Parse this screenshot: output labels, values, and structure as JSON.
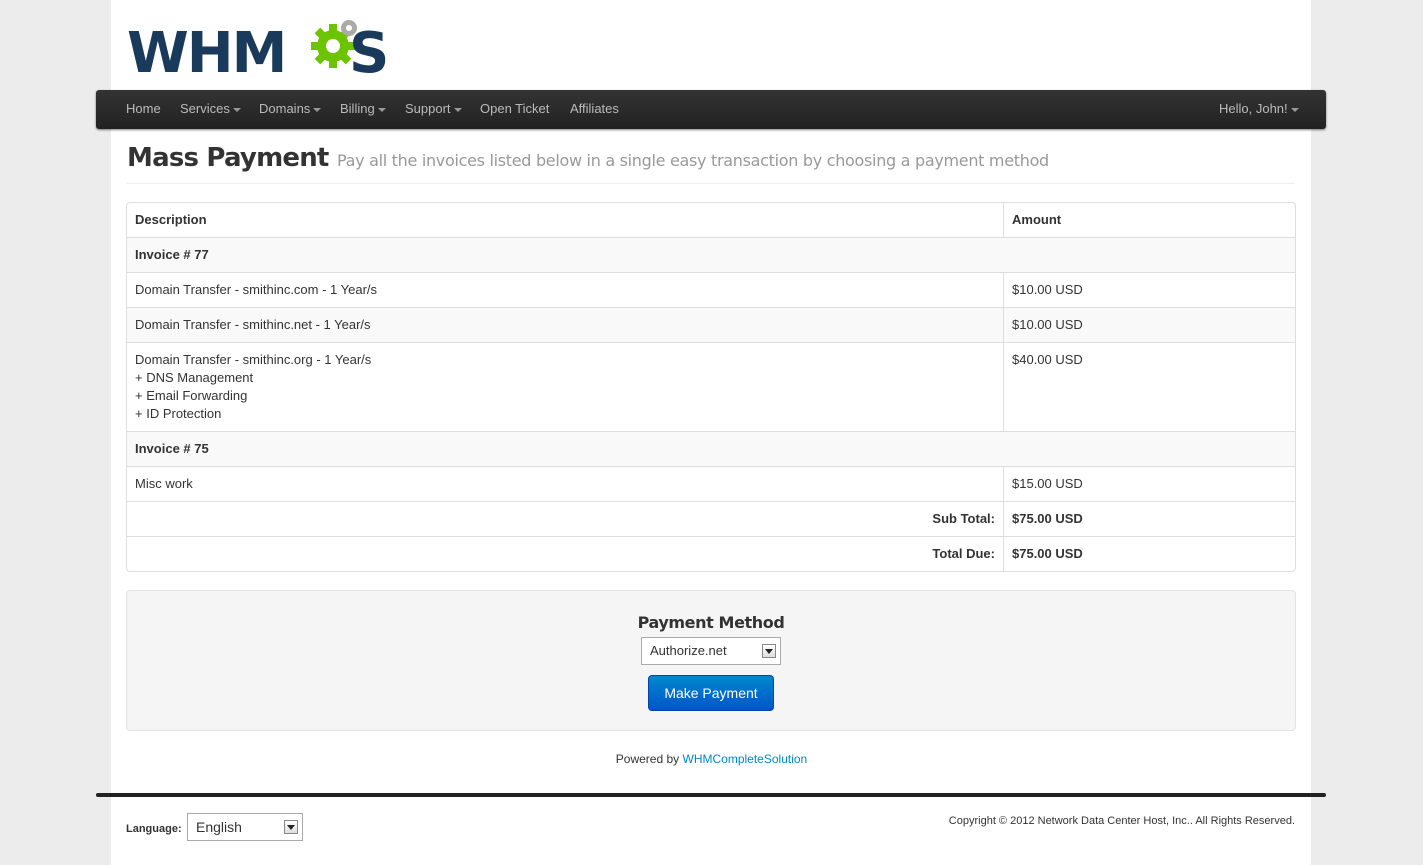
{
  "brand": {
    "logo_text": "WHMCS",
    "colors": {
      "dark_blue": "#1a3a5c",
      "green": "#6cc400",
      "gray_gear": "#999999"
    }
  },
  "nav": {
    "items": [
      {
        "label": "Home",
        "dropdown": false
      },
      {
        "label": "Services",
        "dropdown": true
      },
      {
        "label": "Domains",
        "dropdown": true
      },
      {
        "label": "Billing",
        "dropdown": true
      },
      {
        "label": "Support",
        "dropdown": true
      },
      {
        "label": "Open Ticket",
        "dropdown": false
      },
      {
        "label": "Affiliates",
        "dropdown": false
      }
    ],
    "user_menu": "Hello, John!"
  },
  "page": {
    "title": "Mass Payment",
    "subtitle": "Pay all the invoices listed below in a single easy transaction by choosing a payment method"
  },
  "table": {
    "headers": {
      "description": "Description",
      "amount": "Amount"
    },
    "invoice_77": "Invoice # 77",
    "item_1": {
      "description": "Domain Transfer - smithinc.com - 1 Year/s",
      "amount": "$10.00 USD"
    },
    "item_2": {
      "description": "Domain Transfer - smithinc.net - 1 Year/s",
      "amount": "$10.00 USD"
    },
    "item_3": {
      "lines": [
        "Domain Transfer - smithinc.org - 1 Year/s",
        "+ DNS Management",
        "+ Email Forwarding",
        "+ ID Protection"
      ],
      "amount": "$40.00 USD"
    },
    "invoice_75": "Invoice # 75",
    "item_4": {
      "description": "Misc work",
      "amount": "$15.00 USD"
    },
    "subtotal_label": "Sub Total:",
    "subtotal": "$75.00 USD",
    "total_label": "Total Due:",
    "total": "$75.00 USD"
  },
  "payment": {
    "label": "Payment Method",
    "selected_method": "Authorize.net",
    "button": "Make Payment"
  },
  "footer": {
    "powered_prefix": "Powered by",
    "powered_link": "WHMCompleteSolution",
    "language_label": "Language:",
    "language_selected": "English",
    "copyright": "Copyright © 2012 Network Data Center Host, Inc.. All Rights Reserved."
  }
}
